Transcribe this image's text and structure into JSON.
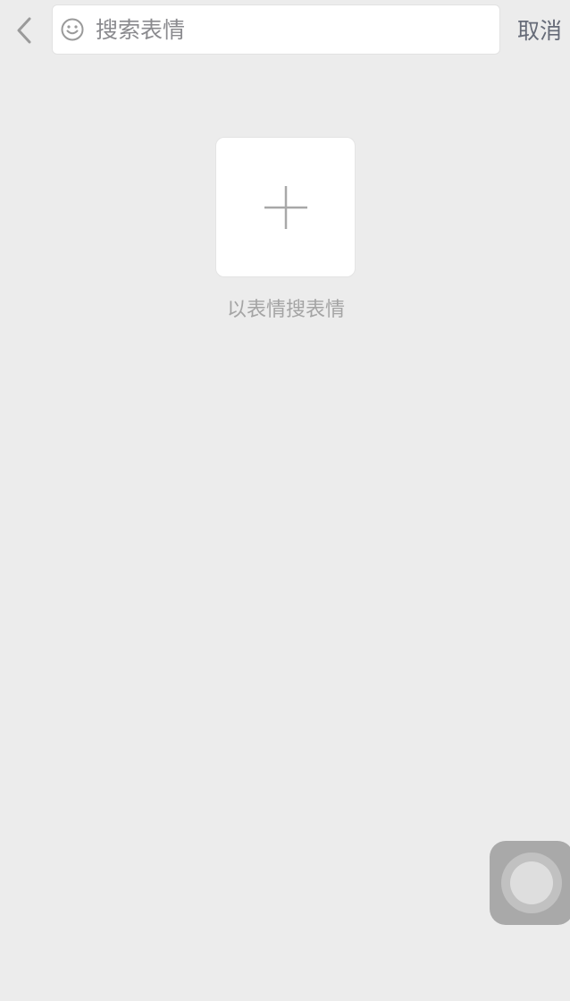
{
  "header": {
    "back_icon": "chevron-left-icon",
    "search": {
      "icon": "smiley-icon",
      "placeholder": "搜索表情",
      "value": ""
    },
    "cancel_label": "取消"
  },
  "main": {
    "upload_icon": "plus-icon",
    "upload_caption": "以表情搜表情"
  },
  "floating": {
    "icon": "assistive-touch-icon"
  },
  "colors": {
    "background": "#ececec",
    "card": "#ffffff",
    "text_muted": "#a4a4a4",
    "cancel": "#666b78"
  }
}
